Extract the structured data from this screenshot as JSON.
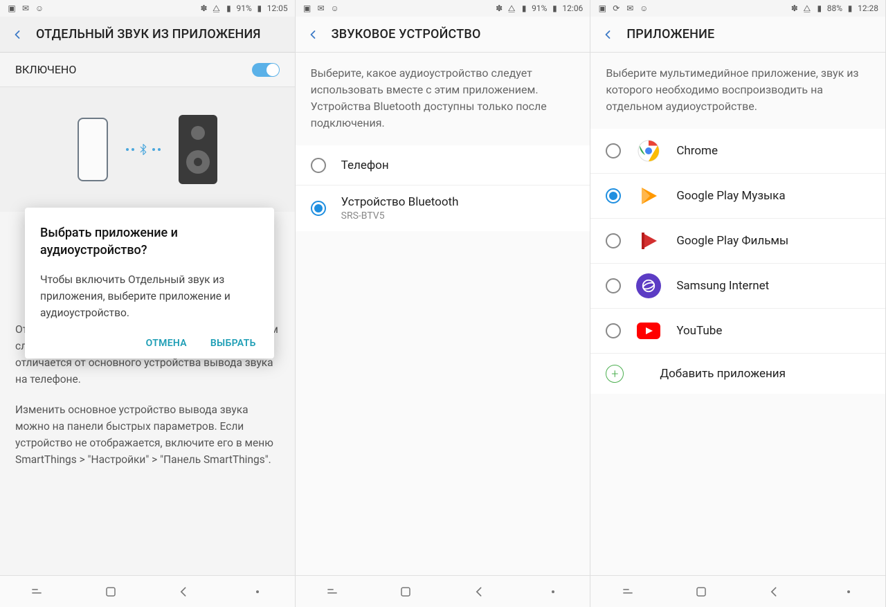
{
  "screen1": {
    "status": {
      "battery": "91%",
      "time": "12:05"
    },
    "header_title": "ОТДЕЛЬНЫЙ ЗВУК ИЗ ПРИЛОЖЕНИЯ",
    "toggle_label": "ВКЛЮЧЕНО",
    "modal": {
      "title": "Выбрать приложение и аудиоустройство?",
      "body": "Чтобы включить Отдельный звук из приложения, выберите приложение и аудиоустройство.",
      "cancel": "ОТМЕНА",
      "confirm": "ВЫБРАТЬ"
    },
    "para1": "Отдельное воспроизведение работает только в том случае, если выбранное звуковое устройство отличается от основного устройства вывода звука на телефоне.",
    "para2": "Изменить основное устройство вывода звука можно на панели быстрых параметров. Если устройство не отображается, включите его в меню SmartThings > \"Настройки\" > \"Панель SmartThings\"."
  },
  "screen2": {
    "status": {
      "battery": "91%",
      "time": "12:06"
    },
    "header_title": "ЗВУКОВОЕ УСТРОЙСТВО",
    "desc": "Выберите, какое аудиоустройство следует использовать вместе с этим приложением. Устройства Bluetooth доступны только после подключения.",
    "items": [
      {
        "title": "Телефон",
        "sub": "",
        "checked": false
      },
      {
        "title": "Устройство Bluetooth",
        "sub": "SRS-BTV5",
        "checked": true
      }
    ]
  },
  "screen3": {
    "status": {
      "battery": "88%",
      "time": "12:28"
    },
    "header_title": "ПРИЛОЖЕНИЕ",
    "desc": "Выберите мультимедийное приложение, звук из которого необходимо воспроизводить на отдельном аудиоустройстве.",
    "items": [
      {
        "title": "Chrome",
        "icon": "chrome",
        "checked": false
      },
      {
        "title": "Google Play Музыка",
        "icon": "play-music",
        "checked": true
      },
      {
        "title": "Google Play Фильмы",
        "icon": "play-movies",
        "checked": false
      },
      {
        "title": "Samsung Internet",
        "icon": "samsung-internet",
        "checked": false
      },
      {
        "title": "YouTube",
        "icon": "youtube",
        "checked": false
      }
    ],
    "add_label": "Добавить приложения"
  }
}
